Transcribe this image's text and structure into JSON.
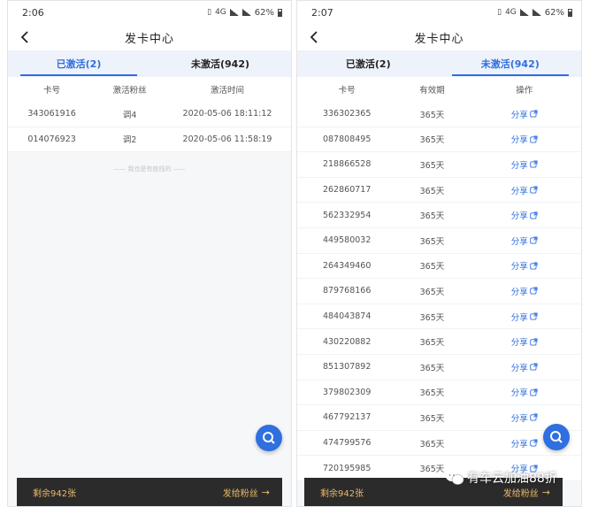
{
  "colors": {
    "accent": "#2f6fe0",
    "bottom_bar": "#2b2b2b",
    "bottom_text": "#e9b96a",
    "tab_bg": "#eef2fa"
  },
  "left": {
    "status": {
      "time": "2:06",
      "network": "4G",
      "battery": "62%"
    },
    "title": "发卡中心",
    "tabs": [
      {
        "label": "已激活(2)",
        "active": true
      },
      {
        "label": "未激活(942)",
        "active": false
      }
    ],
    "columns": [
      "卡号",
      "激活粉丝",
      "激活时间"
    ],
    "rows": [
      [
        "343061916",
        "调4",
        "2020-05-06 18:11:12"
      ],
      [
        "014076923",
        "调2",
        "2020-05-06 11:58:19"
      ]
    ],
    "end_note": "—— 我也是有底线的 ——",
    "bottom": {
      "remaining": "剩余942张",
      "send": "发给粉丝",
      "arrow": "→"
    }
  },
  "right": {
    "status": {
      "time": "2:07",
      "network": "4G",
      "battery": "62%"
    },
    "title": "发卡中心",
    "tabs": [
      {
        "label": "已激活(2)",
        "active": false
      },
      {
        "label": "未激活(942)",
        "active": true
      }
    ],
    "columns": [
      "卡号",
      "有效期",
      "操作"
    ],
    "rows": [
      [
        "336302365",
        "365天",
        "分享"
      ],
      [
        "087808495",
        "365天",
        "分享"
      ],
      [
        "218866528",
        "365天",
        "分享"
      ],
      [
        "262860717",
        "365天",
        "分享"
      ],
      [
        "562332954",
        "365天",
        "分享"
      ],
      [
        "449580032",
        "365天",
        "分享"
      ],
      [
        "264349460",
        "365天",
        "分享"
      ],
      [
        "879768166",
        "365天",
        "分享"
      ],
      [
        "484043874",
        "365天",
        "分享"
      ],
      [
        "430220882",
        "365天",
        "分享"
      ],
      [
        "851307892",
        "365天",
        "分享"
      ],
      [
        "379802309",
        "365天",
        "分享"
      ],
      [
        "467792137",
        "365天",
        "分享"
      ],
      [
        "474799576",
        "365天",
        "分享"
      ],
      [
        "720195985",
        "365天",
        "分享"
      ]
    ],
    "bottom": {
      "remaining": "剩余942张",
      "send": "发给粉丝",
      "arrow": "→"
    }
  },
  "watermark": {
    "text": "有车云加油88折",
    "icon": "wechat-icon"
  }
}
